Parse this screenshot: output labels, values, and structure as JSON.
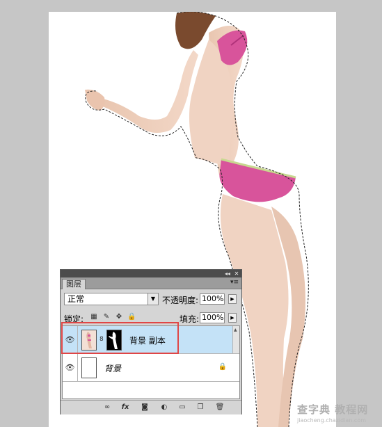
{
  "colors": {
    "workspace": "#c6c6c6",
    "canvas": "#ffffff",
    "selected_row": "#c4e2f7",
    "highlight_border": "#e04646",
    "panel_bg": "#d5d5d5"
  },
  "layers_panel": {
    "collapse_btn": "◂◂",
    "close_btn": "✕",
    "tab_label": "图层",
    "menu_icon": "▾≡",
    "blend_mode": "正常",
    "opacity_label": "不透明度:",
    "opacity_value": "100%",
    "lock_label": "锁定:",
    "fill_label": "填充:",
    "fill_value": "100%",
    "layers": [
      {
        "name": "背景 副本",
        "visible": true,
        "selected": true
      },
      {
        "name": "背景",
        "visible": true,
        "selected": false,
        "locked": true
      }
    ],
    "bottom_icons": [
      "link-icon",
      "fx-icon",
      "mask-icon",
      "adjustment-icon",
      "group-icon",
      "new-layer-icon",
      "trash-icon"
    ]
  },
  "watermark": {
    "main": "查字典 教程网",
    "sub": "jiaocheng.chazidian.com"
  }
}
